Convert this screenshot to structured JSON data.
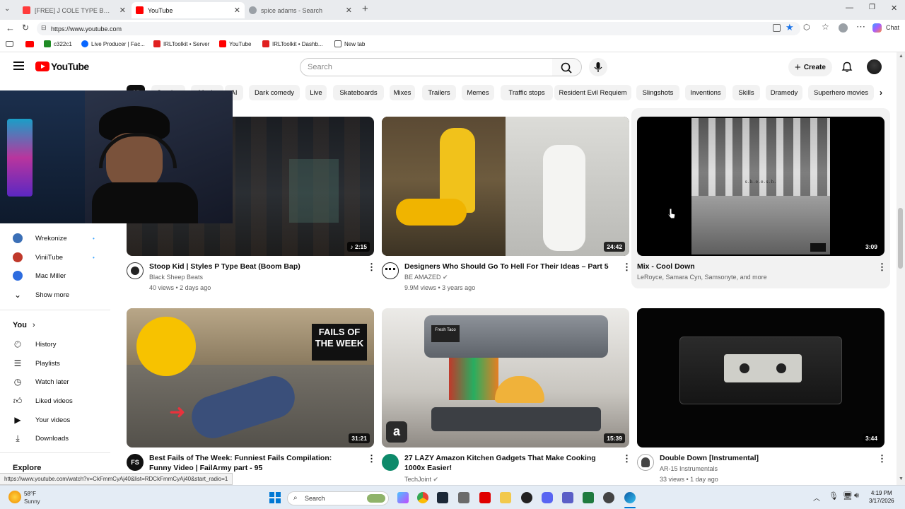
{
  "browser": {
    "tabs": [
      {
        "title": "[FREE] J COLE TYPE BEAT - \"THE M",
        "active": false,
        "favicon_color": "#ff3b3b"
      },
      {
        "title": "YouTube",
        "active": true,
        "favicon_color": "#ff0000"
      },
      {
        "title": "spice adams - Search",
        "active": false,
        "favicon_color": "#9aa0a6"
      }
    ],
    "address": "https://www.youtube.com",
    "chat_label": "Chat",
    "bookmarks": [
      {
        "label": "c322c1",
        "color": "#1f8b24"
      },
      {
        "label": "Live Producer | Fac...",
        "color": "#0866ff"
      },
      {
        "label": "IRLToolkit • Server",
        "color": "#e02020"
      },
      {
        "label": "YouTube",
        "color": "#ff0000"
      },
      {
        "label": "IRLToolkit • Dashb...",
        "color": "#e02020"
      },
      {
        "label": "New tab",
        "color": "#555555"
      }
    ]
  },
  "youtube": {
    "logo_text": "YouTube",
    "search_placeholder": "Search",
    "create_label": "Create",
    "chips": [
      "All",
      "Gaming",
      "Music",
      "AI",
      "Dark comedy",
      "Live",
      "Skateboards",
      "Mixes",
      "Trailers",
      "Memes",
      "Traffic stops",
      "Resident Evil Requiem",
      "Slingshots",
      "Inventions",
      "Skills",
      "Dramedy",
      "Superhero movies"
    ],
    "subscriptions": [
      {
        "name": "Wrekonize",
        "color": "#3b6fb6"
      },
      {
        "name": "ViniiTube",
        "color": "#c0392b"
      },
      {
        "name": "Mac Miller",
        "color": "#2d6cdf"
      }
    ],
    "show_more": "Show more",
    "you_heading": "You",
    "you_items": [
      "History",
      "Playlists",
      "Watch later",
      "Liked videos",
      "Your videos",
      "Downloads"
    ],
    "explore_heading": "Explore",
    "videos": [
      {
        "title": "Stoop Kid | Styles P Type Beat (Boom Bap)",
        "channel": "Black Sheep Beats",
        "stats": "40 views • 2 days ago",
        "duration": "2:15",
        "verified": false,
        "music": true
      },
      {
        "title": "Designers Who Should Go To Hell For Their Ideas – Part 5",
        "channel": "BE AMAZED",
        "stats": "9.9M views • 3 years ago",
        "duration": "24:42",
        "verified": true
      },
      {
        "title": "Mix - Cool Down",
        "channel": "LeRoyce, Samara Cyn, Samsonyte, and more",
        "stats": "",
        "duration": "3:09",
        "verified": false
      },
      {
        "title": "Best Fails of The Week: Funniest Fails Compilation: Funny Video | FailArmy part - 95",
        "channel": "",
        "stats": "",
        "duration": "31:21",
        "verified": false
      },
      {
        "title": "27 LAZY Amazon Kitchen Gadgets That Make Cooking 1000x Easier!",
        "channel": "TechJoint",
        "stats": "",
        "duration": "15:39",
        "verified": true
      },
      {
        "title": "Double Down [Instrumental]",
        "channel": "AR-15 Instrumentals",
        "stats": "33 views • 1 day ago",
        "duration": "3:44",
        "verified": false
      }
    ],
    "thumb_texts": {
      "fails": "FAILS OF THE WEEK",
      "sheesh": "s.h.e.e.s.h.",
      "taco_sign": "Fresh Taco"
    }
  },
  "status_url": "https://www.youtube.com/watch?v=CkFmmCyAj40&list=RDCkFmmCyAj40&start_radio=1",
  "taskbar": {
    "weather_temp": "58°F",
    "weather_desc": "Sunny",
    "search_label": "Search",
    "time": "4:19 PM",
    "date": "3/17/2026"
  }
}
